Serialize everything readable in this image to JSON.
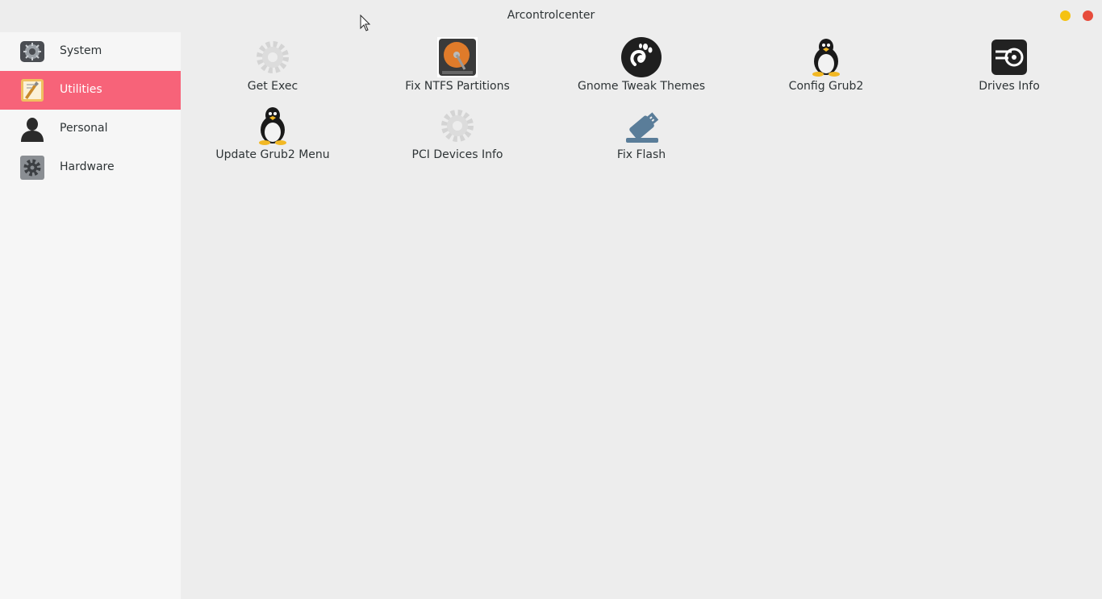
{
  "window": {
    "title": "Arcontrolcenter"
  },
  "sidebar": {
    "items": [
      {
        "label": "System",
        "icon": "system-settings-icon",
        "active": false
      },
      {
        "label": "Utilities",
        "icon": "utilities-icon",
        "active": true
      },
      {
        "label": "Personal",
        "icon": "person-silhouette-icon",
        "active": false
      },
      {
        "label": "Hardware",
        "icon": "gear-icon",
        "active": false
      }
    ]
  },
  "tiles": [
    {
      "label": "Get Exec",
      "icon": "gear-icon"
    },
    {
      "label": "Fix NTFS Partitions",
      "icon": "hard-disk-icon"
    },
    {
      "label": "Gnome Tweak Themes",
      "icon": "gnome-foot-icon"
    },
    {
      "label": "Config Grub2",
      "icon": "tux-penguin-icon"
    },
    {
      "label": "Drives Info",
      "icon": "drive-icon"
    },
    {
      "label": "Update Grub2 Menu",
      "icon": "tux-penguin-icon"
    },
    {
      "label": "PCI Devices Info",
      "icon": "gear-icon"
    },
    {
      "label": "Fix Flash",
      "icon": "usb-flash-drive-icon"
    }
  ],
  "colors": {
    "accent": "#f76379",
    "minimize": "#f5c211",
    "close": "#e74c3c"
  }
}
